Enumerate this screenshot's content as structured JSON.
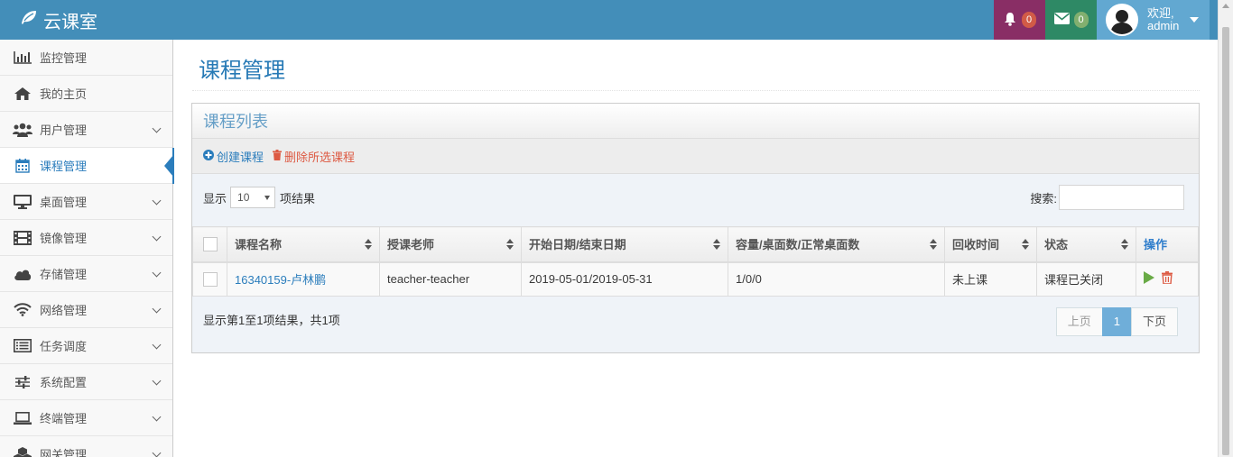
{
  "brand": {
    "name": "云课室"
  },
  "navbar": {
    "notifications_count": "0",
    "messages_count": "0",
    "welcome": "欢迎,",
    "username": "admin"
  },
  "sidebar": {
    "items": [
      {
        "label": "监控管理",
        "icon": "bar-chart-icon"
      },
      {
        "label": "我的主页",
        "icon": "home-icon"
      },
      {
        "label": "用户管理",
        "icon": "users-icon"
      },
      {
        "label": "课程管理",
        "icon": "calendar-icon"
      },
      {
        "label": "桌面管理",
        "icon": "desktop-icon"
      },
      {
        "label": "镜像管理",
        "icon": "film-icon"
      },
      {
        "label": "存储管理",
        "icon": "cloud-icon"
      },
      {
        "label": "网络管理",
        "icon": "wifi-icon"
      },
      {
        "label": "任务调度",
        "icon": "list-icon"
      },
      {
        "label": "系统配置",
        "icon": "sliders-icon"
      },
      {
        "label": "终端管理",
        "icon": "laptop-icon"
      },
      {
        "label": "网关管理",
        "icon": "cubes-icon"
      }
    ],
    "active": "课程管理"
  },
  "page": {
    "title": "课程管理"
  },
  "widget": {
    "title": "课程列表",
    "create_label": "创建课程",
    "delete_label": "删除所选课程",
    "show_label": "显示",
    "page_length": "10",
    "results_label": "项结果",
    "search_label": "搜索:",
    "search_value": ""
  },
  "table": {
    "columns": [
      "课程名称",
      "授课老师",
      "开始日期/结束日期",
      "容量/桌面数/正常桌面数",
      "回收时间",
      "状态",
      "操作"
    ],
    "rows": [
      {
        "name": "16340159-卢林鹏",
        "teacher": "teacher-teacher",
        "dates": "2019-05-01/2019-05-31",
        "capacity": "1/0/0",
        "recycle": "未上课",
        "status": "课程已关闭"
      }
    ]
  },
  "pagination": {
    "info": "显示第1至1项结果，共1项",
    "prev": "上页",
    "current": "1",
    "next": "下页"
  },
  "colors": {
    "navbar": "#438eb9",
    "bell": "#892e65",
    "mail": "#2e8965",
    "user": "#62a8d1",
    "accent": "#2b7dbc",
    "danger": "#dd5a43",
    "play": "#69aa46"
  }
}
